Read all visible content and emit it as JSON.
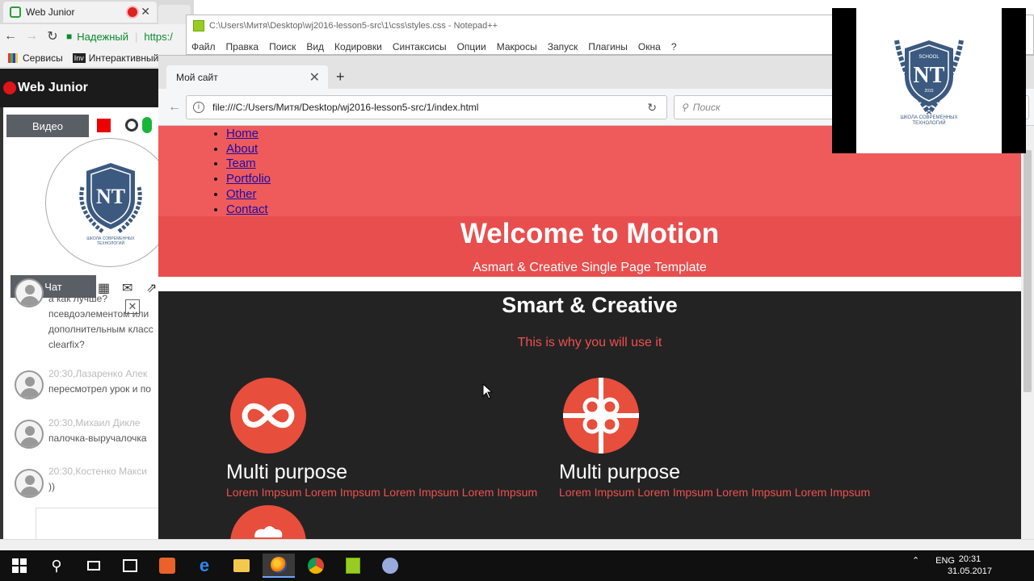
{
  "chrome": {
    "tab_title": "Web Junior",
    "secure_label": "Надежный",
    "url_partial": "https:/",
    "bookmarks": [
      "Сервисы",
      "Интерактивный г"
    ]
  },
  "webjunior": {
    "brand": "Web Junior",
    "video_label": "Видео",
    "chat_label": "Чат",
    "messages": [
      {
        "meta": "",
        "lines": [
          "а как лучше?",
          "псевдоэлементом или",
          "дополнительным класс",
          "clearfix?"
        ]
      },
      {
        "meta": "20:30,Лазаренко Алек",
        "lines": [
          "пересмотрел урок и по"
        ]
      },
      {
        "meta": "20:30,Михаил Дикле",
        "lines": [
          "палочка-выручалочка"
        ]
      },
      {
        "meta": "20:30,Костенко Макси",
        "lines": [
          "))"
        ]
      }
    ]
  },
  "notepad": {
    "title": "C:\\Users\\Митя\\Desktop\\wj2016-lesson5-src\\1\\css\\styles.css - Notepad++",
    "menu": [
      "Файл",
      "Правка",
      "Поиск",
      "Вид",
      "Кодировки",
      "Синтаксисы",
      "Опции",
      "Макросы",
      "Запуск",
      "Плагины",
      "Окна",
      "?"
    ]
  },
  "firefox": {
    "tab_title": "Мой сайт",
    "url": "file:///C:/Users/Митя/Desktop/wj2016-lesson5-src/1/index.html",
    "search_placeholder": "Поиск"
  },
  "site": {
    "nav": [
      "Home",
      "About",
      "Team",
      "Portfolio",
      "Other",
      "Contact"
    ],
    "hero_title": "Welcome to Motion",
    "hero_subtitle": "Asmart & Creative Single Page Template",
    "section_title": "Smart & Creative",
    "section_subtitle": "This is why you will use it",
    "features": [
      {
        "title": "Multi purpose",
        "text": "Lorem Impsum Lorem Impsum Lorem Impsum Lorem Impsum",
        "icon": "infinity-icon"
      },
      {
        "title": "Multi purpose",
        "text": "Lorem Impsum Lorem Impsum Lorem Impsum Lorem Impsum",
        "icon": "gift-icon"
      }
    ]
  },
  "logo": {
    "top_text": "SCHOOL",
    "letters": "NT",
    "year": "2015",
    "caption1": "ШКОЛА СОВРЕМЕННЫХ",
    "caption2": "ТЕХНОЛОГИЙ"
  },
  "taskbar": {
    "lang": "ENG",
    "time": "20:31",
    "date": "31.05.2017"
  },
  "colors": {
    "hero": "#ef5b5b",
    "accent": "#e84e4e",
    "dark": "#232323"
  }
}
